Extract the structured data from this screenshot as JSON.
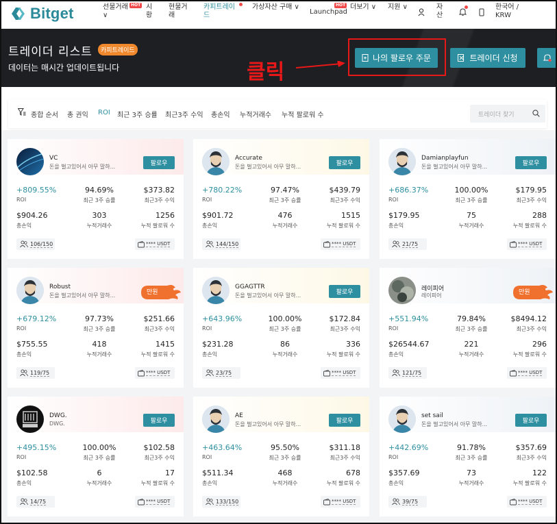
{
  "nav": {
    "logo_text": "Bitget",
    "items": [
      {
        "label_line1": "선물거래",
        "label_line2": "∨",
        "hot": "HOT"
      },
      {
        "label_line1": "시",
        "label_line2": "황"
      },
      {
        "label_line1": "현물거",
        "label_line2": "래"
      },
      {
        "label_line1": "카피트레이",
        "label_line2": "드"
      },
      {
        "label": "가상자산 구매 ∨"
      },
      {
        "label": "Launchpad",
        "hot": "HOT"
      },
      {
        "label": "더보기 ∨"
      },
      {
        "label": "지원 ∨"
      },
      {
        "label_line1": "자",
        "label_line2": "산"
      },
      {
        "label_line1": "한국어 /",
        "label_line2": "KRW"
      }
    ]
  },
  "header": {
    "title": "트레이더 리스트",
    "badge": "카피트레이드",
    "subtitle": "데이터는 매시간 업데이트됩니다",
    "click_annotation": "클릭",
    "my_follow_orders": "나의 팔로우 주문",
    "apply_trader": "트레이더 신청"
  },
  "filter": {
    "items": [
      "종합 순서",
      "총 권익",
      "ROI",
      "최근 3주 승률",
      "최근3주 수익",
      "총손익",
      "누적거래수",
      "누적 팔로워 수"
    ],
    "active_index": 2,
    "search_placeholder": "트레이더 찾기"
  },
  "labels": {
    "roi": "ROI",
    "winrate": "최근 3주 승률",
    "profit3w": "최근3주 수익",
    "total_pnl": "총손익",
    "trades": "누적거래수",
    "followers": "누적 팔로워 수",
    "follow": "팔로우",
    "full": "만원",
    "usdt": "**** USDT"
  },
  "traders": [
    {
      "name": "VC",
      "desc": "돈을 벌고있어서 아무 말하...",
      "roi": "+809.55%",
      "winrate": "94.69%",
      "profit3w": "$373.82",
      "pnl": "$904.26",
      "trades": "303",
      "followers": "1256",
      "slots": "106/150",
      "full": false,
      "avatar": "abstract"
    },
    {
      "name": "Accurate",
      "desc": "돈을 벌고있어서 아무 말하...",
      "roi": "+780.22%",
      "winrate": "97.47%",
      "profit3w": "$439.79",
      "pnl": "$901.72",
      "trades": "476",
      "followers": "1515",
      "slots": "144/150",
      "full": false,
      "avatar": "default"
    },
    {
      "name": "Damianplayfun",
      "desc": "돈을 벌고있어서 아무 말하...",
      "roi": "+686.37%",
      "winrate": "100.00%",
      "profit3w": "$179.95",
      "pnl": "$179.95",
      "trades": "75",
      "followers": "288",
      "slots": "21/75",
      "full": false,
      "avatar": "default"
    },
    {
      "name": "Robust",
      "desc": "돈을 벌고있어서 아무 말하...",
      "roi": "+679.12%",
      "winrate": "97.73%",
      "profit3w": "$251.66",
      "pnl": "$755.55",
      "trades": "418",
      "followers": "1415",
      "slots": "119/75",
      "full": true,
      "avatar": "default"
    },
    {
      "name": "GGAGTTR",
      "desc": "돈을 벌고있어서 아무 말하...",
      "roi": "+643.96%",
      "winrate": "100.00%",
      "profit3w": "$172.84",
      "pnl": "$231.28",
      "trades": "86",
      "followers": "336",
      "slots": "23/75",
      "full": false,
      "avatar": "default"
    },
    {
      "name": "레이피어",
      "desc": "레이피어",
      "roi": "+551.94%",
      "winrate": "79.84%",
      "profit3w": "$8494.12",
      "pnl": "$26544.67",
      "trades": "221",
      "followers": "296",
      "slots": "121/75",
      "full": true,
      "avatar": "photo"
    },
    {
      "name": "DWG.",
      "desc": "DWG.",
      "roi": "+495.15%",
      "winrate": "100.00%",
      "profit3w": "$102.58",
      "pnl": "$102.58",
      "trades": "6",
      "followers": "17",
      "slots": "14/75",
      "full": false,
      "avatar": "dwg"
    },
    {
      "name": "AE",
      "desc": "돈을 벌고있어서 아무 말하...",
      "roi": "+463.64%",
      "winrate": "95.50%",
      "profit3w": "$311.18",
      "pnl": "$511.34",
      "trades": "468",
      "followers": "678",
      "slots": "133/150",
      "full": false,
      "avatar": "default"
    },
    {
      "name": "set sail",
      "desc": "돈을 벌고있어서 아무 말하...",
      "roi": "+442.69%",
      "winrate": "91.78%",
      "profit3w": "$357.69",
      "pnl": "$357.69",
      "trades": "73",
      "followers": "122",
      "slots": "39/75",
      "full": false,
      "avatar": "default"
    }
  ],
  "colors": {
    "brand": "#2e8fa0",
    "full_badge": "#f0702e",
    "annotation": "#e81818"
  }
}
